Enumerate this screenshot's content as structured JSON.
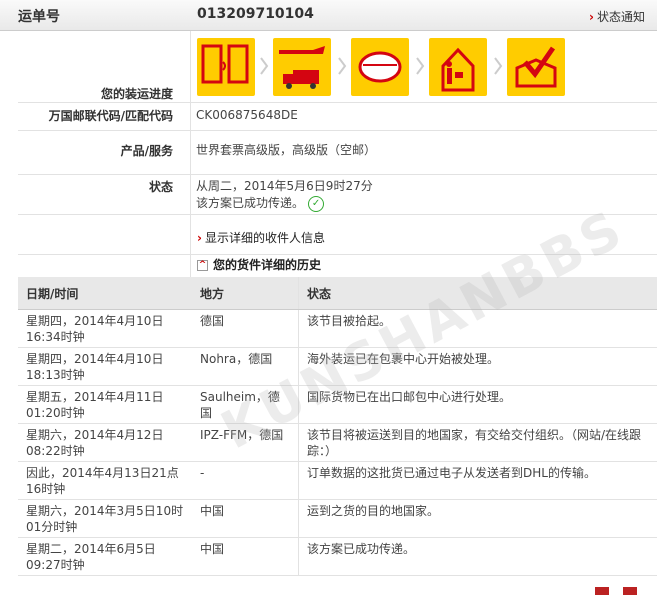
{
  "header": {
    "waybill_label": "运单号",
    "waybill_number": "013209710104",
    "notify_label": "状态通知"
  },
  "details": {
    "progress_label": "您的装运进度",
    "upu_label": "万国邮联代码/匹配代码",
    "upu_value": "CK006875648DE",
    "product_label": "产品/服务",
    "product_value": "世界套票高级版，高级版（空邮）",
    "status_label": "状态",
    "status_line1": "从周二，2014年5月6日9时27分",
    "status_line2": "该方案已成功传递。",
    "recipient_link": "显示详细的收件人信息",
    "history_title": "您的货件详细的历史"
  },
  "progress_steps": [
    {
      "icon": "mobile-tracking-icon",
      "done": true
    },
    {
      "icon": "airplane-truck-icon",
      "done": true
    },
    {
      "icon": "border-frontier-icon",
      "done": true
    },
    {
      "icon": "courier-delivery-icon",
      "done": true
    },
    {
      "icon": "delivered-box-check-icon",
      "done": true
    }
  ],
  "history": {
    "columns": [
      "日期/时间",
      "地方",
      "状态"
    ],
    "rows": [
      {
        "date": "星期四，2014年4月10日\n16:34时钟",
        "place": "德国",
        "status": "该节目被拾起。"
      },
      {
        "date": "星期四，2014年4月10日\n18:13时钟",
        "place": "Nohra，德国",
        "status": "海外装运已在包裹中心开始被处理。"
      },
      {
        "date": "星期五，2014年4月11日\n01:20时钟",
        "place": "Saulheim，德国",
        "status": "国际货物已在出口邮包中心进行处理。"
      },
      {
        "date": "星期六，2014年4月12日\n08:22时钟",
        "place": "IPZ-FFM，德国",
        "status": "该节目将被运送到目的地国家，有交给交付组织。（网站/在线跟踪：）"
      },
      {
        "date": "因此，2014年4月13日21点16时钟",
        "place": "-",
        "status": "订单数据的这批货已通过电子从发送者到DHL的传输。"
      },
      {
        "date": "星期六，2014年3月5日10时01分时钟",
        "place": "中国",
        "status": "运到之货的目的地国家。"
      },
      {
        "date": "星期二，2014年6月5日\n09:27时钟",
        "place": "中国",
        "status": "该方案已成功传递。"
      }
    ]
  },
  "watermark": "KUNSHANBBS",
  "colors": {
    "dhl_yellow": "#ffcc00",
    "dhl_red": "#d40511",
    "check_green": "#33aa33"
  }
}
